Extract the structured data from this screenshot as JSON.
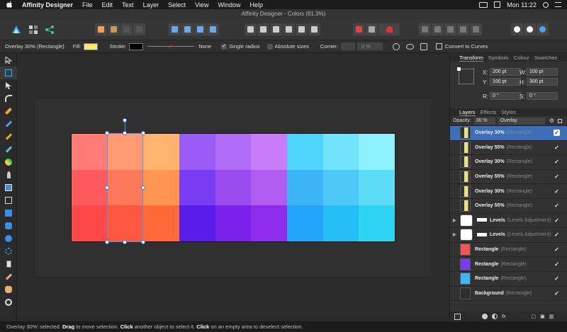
{
  "menubar": {
    "app_name": "Affinity Designer",
    "items": [
      "File",
      "Edit",
      "Text",
      "Layer",
      "Select",
      "View",
      "Window",
      "Help"
    ],
    "clock": "Mon 11:22"
  },
  "window": {
    "title": "Affinity Designer - Colors (81.3%)"
  },
  "context": {
    "selection": "Overlay 30% (Rectangle)",
    "fill_label": "Fill:",
    "fill_color": "#f7e674",
    "stroke_label": "Stroke:",
    "stroke_color": "#000000",
    "stroke_style": "None",
    "single_radius": "Single radius",
    "absolute_sizes": "Absolute sizes",
    "corner_label": "Corner:",
    "corner_value": "0 %",
    "convert": "Convert to Curves"
  },
  "transform": {
    "tabs": [
      "Transform",
      "Symbols",
      "Colour",
      "Swatches"
    ],
    "x_label": "X:",
    "x": "200 pt",
    "w_label": "W:",
    "w": "100 pt",
    "y_label": "Y:",
    "y": "100 pt",
    "h_label": "H:",
    "h": "300 pt",
    "r_label": "R:",
    "r": "0 °",
    "s_label": "S:",
    "s": "0 °"
  },
  "layers_panel": {
    "tabs": [
      "Layers",
      "Effects",
      "Styles"
    ],
    "opacity_label": "Opacity:",
    "opacity": "30 %",
    "blend_mode": "Overlay",
    "layers": [
      {
        "name": "Overlay 30%",
        "type": "(Rectangle)",
        "selected": true,
        "thumb": "#e8df8a"
      },
      {
        "name": "Overlay 55%",
        "type": "(Rectangle)",
        "selected": false,
        "thumb": "#e8df8a"
      },
      {
        "name": "Overlay 30%",
        "type": "(Rectangle)",
        "selected": false,
        "thumb": "#e8df8a"
      },
      {
        "name": "Overlay 55%",
        "type": "(Rectangle)",
        "selected": false,
        "thumb": "#e8df8a"
      },
      {
        "name": "Overlay 30%",
        "type": "(Rectangle)",
        "selected": false,
        "thumb": "#e8df8a"
      },
      {
        "name": "Overlay 55%",
        "type": "(Rectangle)",
        "selected": false,
        "thumb": "#e8df8a"
      },
      {
        "name": "Levels",
        "type": "(Levels Adjustment)",
        "selected": false,
        "thumb": "#ffffff"
      },
      {
        "name": "Levels",
        "type": "(Levels Adjustment)",
        "selected": false,
        "thumb": "#ffffff"
      },
      {
        "name": "Rectangle",
        "type": "(Rectangle)",
        "selected": false,
        "thumb": "#f25555"
      },
      {
        "name": "Rectangle",
        "type": "(Rectangle)",
        "selected": false,
        "thumb": "#7a3cf0"
      },
      {
        "name": "Rectangle",
        "type": "(Rectangle)",
        "selected": false,
        "thumb": "#3cb4f5"
      },
      {
        "name": "Background",
        "type": "(Rectangle)",
        "selected": false,
        "thumb": "#2e2e2e"
      }
    ]
  },
  "canvas": {
    "swatch_colors": [
      "#ff7c78",
      "#ff9a72",
      "#ffb36e",
      "#9a5cf4",
      "#b06cf5",
      "#c87cf7",
      "#4fd4fb",
      "#6fe4fb",
      "#8ff0fd",
      "#ff5a5e",
      "#ff7a5c",
      "#ff9550",
      "#7a3cf0",
      "#9a4cf0",
      "#b05cf0",
      "#3cb4f5",
      "#4ec8f7",
      "#5cdcf6",
      "#ff4848",
      "#ff5840",
      "#ff6a3a",
      "#5a1ceb",
      "#7a22ec",
      "#8e2cec",
      "#22a4f8",
      "#26bcf6",
      "#2ed4f2"
    ]
  },
  "status": {
    "sel": "'Overlay 30%' selected.",
    "drag": "Drag",
    "t1": " to move selection. ",
    "click1": "Click",
    "t2": " another object to select it. ",
    "click2": "Click",
    "t3": " on an empty area to deselect selection."
  }
}
